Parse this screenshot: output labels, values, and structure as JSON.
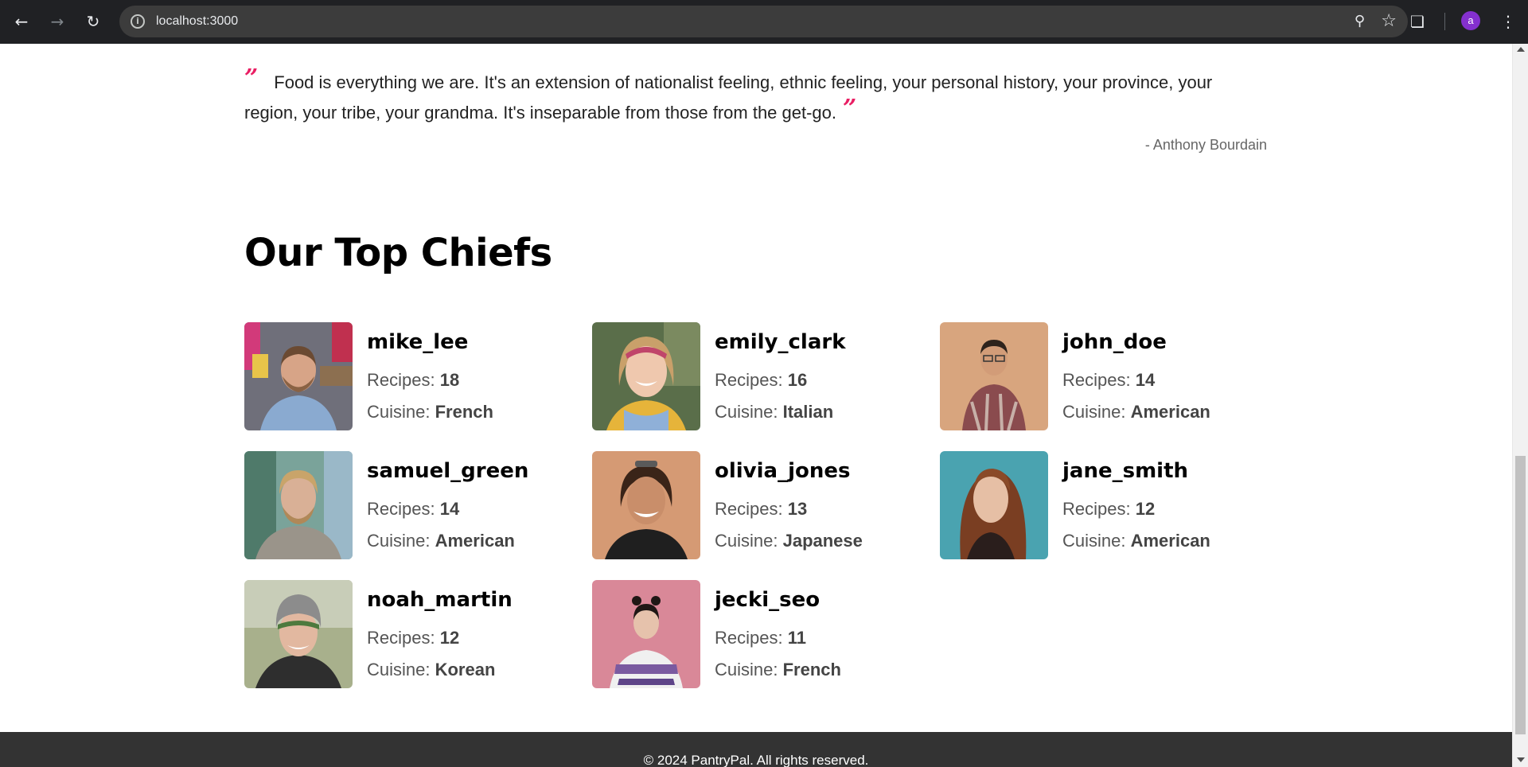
{
  "browser": {
    "url": "localhost:3000",
    "profile_initial": "a",
    "icons": [
      "back-icon",
      "forward-icon",
      "reload-icon",
      "info-icon",
      "zoom-icon",
      "star-icon",
      "extensions-icon",
      "kebab-menu-icon"
    ]
  },
  "quote": {
    "open_mark": "”",
    "close_mark": "”",
    "text": "Food is everything we are. It's an extension of nationalist feeling, ethnic feeling, your personal history, your province, your region, your tribe, your grandma. It's inseparable from those from the get-go.",
    "author": "- Anthony Bourdain",
    "accent_color": "#e91e63"
  },
  "section": {
    "title": "Our Top Chiefs"
  },
  "labels": {
    "recipes": "Recipes: ",
    "cuisine": "Cuisine: "
  },
  "chefs": [
    {
      "name": "mike_lee",
      "recipes": "18",
      "cuisine": "French"
    },
    {
      "name": "emily_clark",
      "recipes": "16",
      "cuisine": "Italian"
    },
    {
      "name": "john_doe",
      "recipes": "14",
      "cuisine": "American"
    },
    {
      "name": "samuel_green",
      "recipes": "14",
      "cuisine": "American"
    },
    {
      "name": "olivia_jones",
      "recipes": "13",
      "cuisine": "Japanese"
    },
    {
      "name": "jane_smith",
      "recipes": "12",
      "cuisine": "American"
    },
    {
      "name": "noah_martin",
      "recipes": "12",
      "cuisine": "Korean"
    },
    {
      "name": "jecki_seo",
      "recipes": "11",
      "cuisine": "French"
    }
  ],
  "footer": {
    "text": "© 2024 PantryPal. All rights reserved."
  }
}
